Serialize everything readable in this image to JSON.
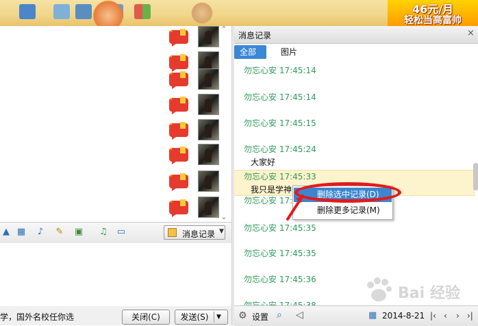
{
  "top_banner": {
    "ad_line1": "46元/月",
    "ad_line2": "轻松当高富帅"
  },
  "chat": {
    "message_rows": 8,
    "toolbar": {
      "tools": [
        "pen-tool-icon",
        "screenshot-icon",
        "microphone-icon",
        "edit-icon",
        "image-icon",
        "music-icon",
        "screen-share-icon"
      ],
      "history_label": "消息记录"
    },
    "input_text": "学，国外名校任你选",
    "close_label": "关闭(C)",
    "send_label": "发送(S)"
  },
  "history": {
    "title": "消息记录",
    "close_icon": "×",
    "tabs": [
      {
        "label": "全部",
        "active": true
      },
      {
        "label": "图片",
        "active": false
      }
    ],
    "records": [
      {
        "sender": "勿忘心安",
        "time": "17:45:14",
        "text": ""
      },
      {
        "sender": "勿忘心安",
        "time": "17:45:14",
        "text": ""
      },
      {
        "sender": "勿忘心安",
        "time": "17:45:15",
        "text": ""
      },
      {
        "sender": "勿忘心安",
        "time": "17:45:24",
        "text": "大家好"
      },
      {
        "sender": "勿忘心安",
        "time": "17:45:33",
        "text": "我只是学神"
      },
      {
        "sender": "勿忘心安",
        "time": "17:4",
        "text": ""
      },
      {
        "sender": "勿忘心安",
        "time": "17:45:35",
        "text": ""
      },
      {
        "sender": "勿忘心安",
        "time": "17:45:35",
        "text": ""
      },
      {
        "sender": "勿忘心安",
        "time": "17:45:36",
        "text": ""
      },
      {
        "sender": "勿忘心安",
        "time": "17:45:38",
        "text": ""
      }
    ],
    "footer": {
      "settings_label": "设置",
      "date": "2014-8-21"
    }
  },
  "context_menu": {
    "items": [
      "删除选中记录(D)",
      "删除更多记录(M)"
    ]
  },
  "watermark": {
    "text": "Bai 经验"
  },
  "colors": {
    "sender_green": "#2f9b5b",
    "menu_highlight": "#3c86d0",
    "selected_row": "#fdf3cd",
    "annotation_red": "#e21b1b"
  }
}
